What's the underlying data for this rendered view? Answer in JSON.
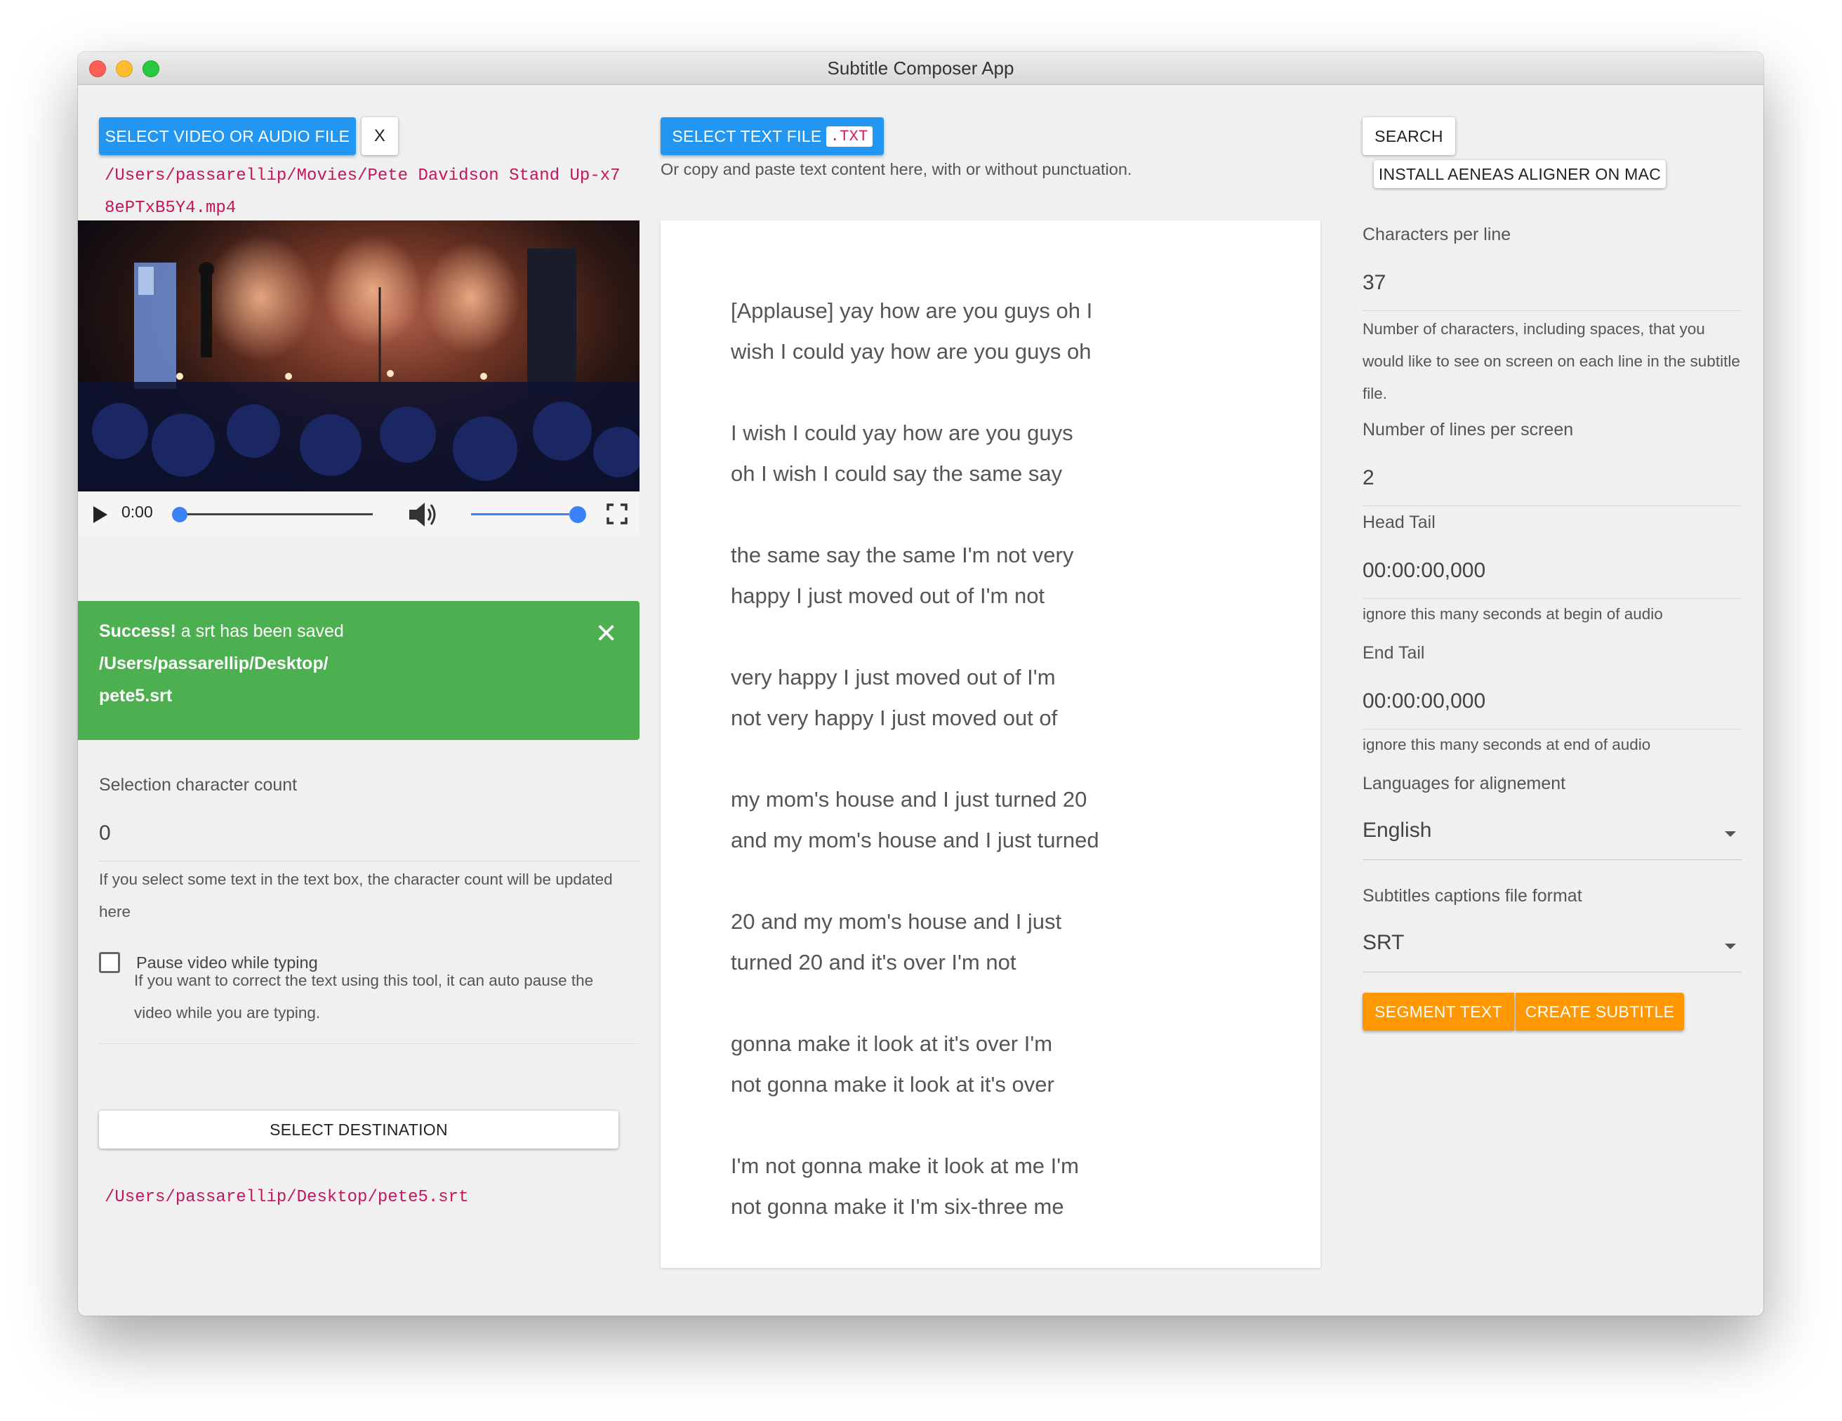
{
  "window": {
    "title": "Subtitle Composer App"
  },
  "left": {
    "select_media_label": "SELECT VIDEO OR AUDIO FILE",
    "clear_label": "X",
    "media_path": "/Users/passarellip/Movies/Pete Davidson Stand Up-x78ePTxB5Y4.mp4",
    "player": {
      "time": "0:00",
      "progress": 0,
      "volume": 1.0
    },
    "alert": {
      "strong": "Success!",
      "message": " a srt has been saved",
      "path_line1": "/Users/passarellip/Desktop/",
      "path_line2": "pete5.srt",
      "close": "×"
    },
    "selection_count_label": "Selection character count",
    "selection_count_value": "0",
    "selection_help": "If you select some text in the text box, the character count will be updated here",
    "pause_label": "Pause video while typing",
    "pause_checked": false,
    "pause_help": "If you want to correct the text using this tool, it can auto pause the video while you are typing.",
    "destination_button": "SELECT DESTINATION",
    "destination_path": "/Users/passarellip/Desktop/pete5.srt"
  },
  "middle": {
    "select_text_label": "SELECT TEXT FILE",
    "txt_badge": ".TXT",
    "hint": "Or copy and paste text content here, with or without punctuation.",
    "paragraphs": [
      [
        "[Applause] yay how are you guys oh I",
        "wish I could yay how are you guys oh"
      ],
      [
        "I wish I could yay how are you guys",
        "oh I wish I could say the same say"
      ],
      [
        "the same say the same I'm not very",
        "happy I just moved out of I'm not"
      ],
      [
        "very happy I just moved out of I'm",
        "not very happy I just moved out of"
      ],
      [
        "my mom's house and I just turned 20",
        "and my mom's house and I just turned"
      ],
      [
        "20 and my mom's house and I just",
        "turned 20 and it's over I'm not"
      ],
      [
        "gonna make it look at it's over I'm",
        "not gonna make it look at it's over"
      ],
      [
        "I'm not gonna make it look at me I'm",
        "not gonna make it I'm six-three me"
      ]
    ]
  },
  "right": {
    "search_label": "SEARCH",
    "install_label": "INSTALL AENEAS ALIGNER ON MAC",
    "cpl_label": "Characters per line",
    "cpl_value": "37",
    "cpl_help": "Number of characters, including spaces, that you would like to see on screen on each line in the subtitle file.",
    "lines_label": "Number of lines per screen",
    "lines_value": "2",
    "head_label": "Head Tail",
    "head_value": "00:00:00,000",
    "head_help": "ignore this many seconds at begin of audio",
    "end_label": "End Tail",
    "end_value": "00:00:00,000",
    "end_help": "ignore this many seconds at end of audio",
    "lang_label": "Languages for alignement",
    "lang_value": "English",
    "format_label": "Subtitles captions file format",
    "format_value": "SRT",
    "segment_label": "SEGMENT TEXT",
    "create_label": "CREATE SUBTITLE"
  },
  "colors": {
    "primary": "#2196f3",
    "success": "#4caf50",
    "accent": "#ff9800",
    "path": "#c2185b"
  }
}
